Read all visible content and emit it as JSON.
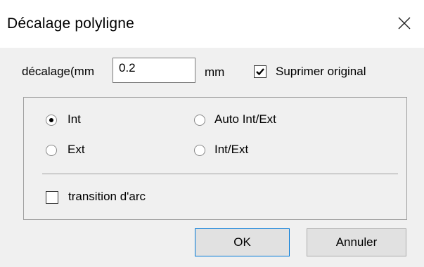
{
  "window": {
    "title": "Décalage polyligne"
  },
  "offset": {
    "label": "décalage(mm",
    "value": "0.2",
    "unit": "mm"
  },
  "delete_original": {
    "label": "Suprimer original",
    "checked": true
  },
  "direction": {
    "options": [
      {
        "label": "Int",
        "selected": true
      },
      {
        "label": "Auto Int/Ext",
        "selected": false
      },
      {
        "label": "Ext",
        "selected": false
      },
      {
        "label": "Int/Ext",
        "selected": false
      }
    ]
  },
  "arc_transition": {
    "label": "transition d'arc",
    "checked": false
  },
  "buttons": {
    "ok": "OK",
    "cancel": "Annuler"
  }
}
